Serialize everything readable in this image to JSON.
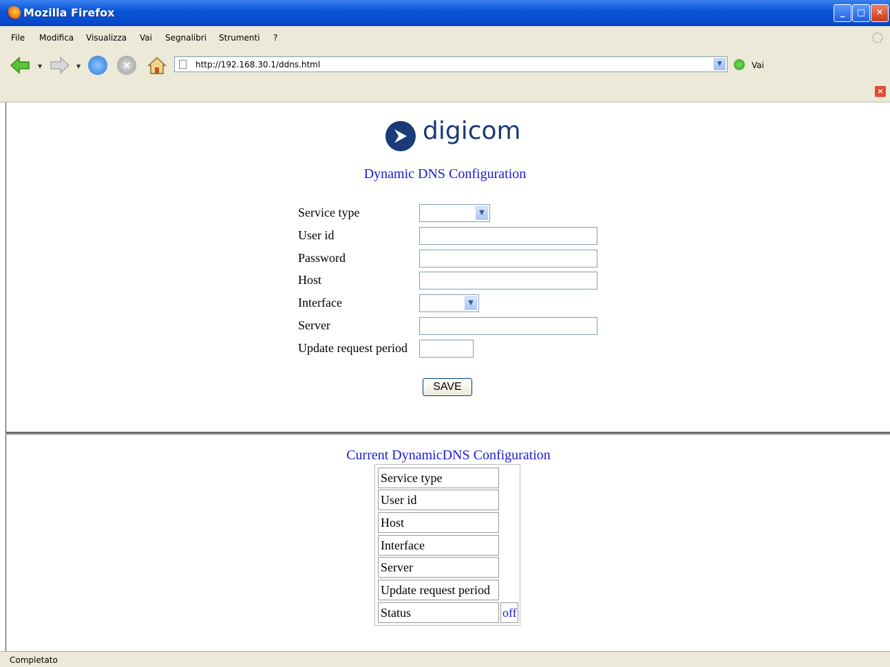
{
  "window": {
    "title": "Mozilla Firefox"
  },
  "menu": {
    "items": [
      "File",
      "Modifica",
      "Visualizza",
      "Vai",
      "Segnalibri",
      "Strumenti",
      "?"
    ]
  },
  "navbar": {
    "url": "http://192.168.30.1/ddns.html",
    "go_label": "Vai"
  },
  "page": {
    "logo_text": "digicom",
    "form_title": "Dynamic DNS Configuration",
    "fields": {
      "service_type": "Service type",
      "user_id": "User id",
      "password": "Password",
      "host": "Host",
      "interface": "Interface",
      "server": "Server",
      "update_period": "Update request period"
    },
    "save_label": "SAVE",
    "current_title": "Current DynamicDNS Configuration",
    "current_rows": {
      "service_type": "Service type",
      "user_id": "User id",
      "host": "Host",
      "interface": "Interface",
      "server": "Server",
      "update_period": "Update request period",
      "status": "Status",
      "status_value": "off"
    }
  },
  "status": {
    "text": "Completato"
  },
  "icons": {
    "app": "firefox-icon",
    "back": "back-arrow-icon",
    "forward": "forward-arrow-icon",
    "reload": "reload-icon",
    "stop": "stop-icon",
    "home": "home-icon",
    "go": "go-icon",
    "close_infobar": "close-icon"
  },
  "colors": {
    "title_blue": "#1a1adc",
    "brand": "#1a3a78"
  }
}
